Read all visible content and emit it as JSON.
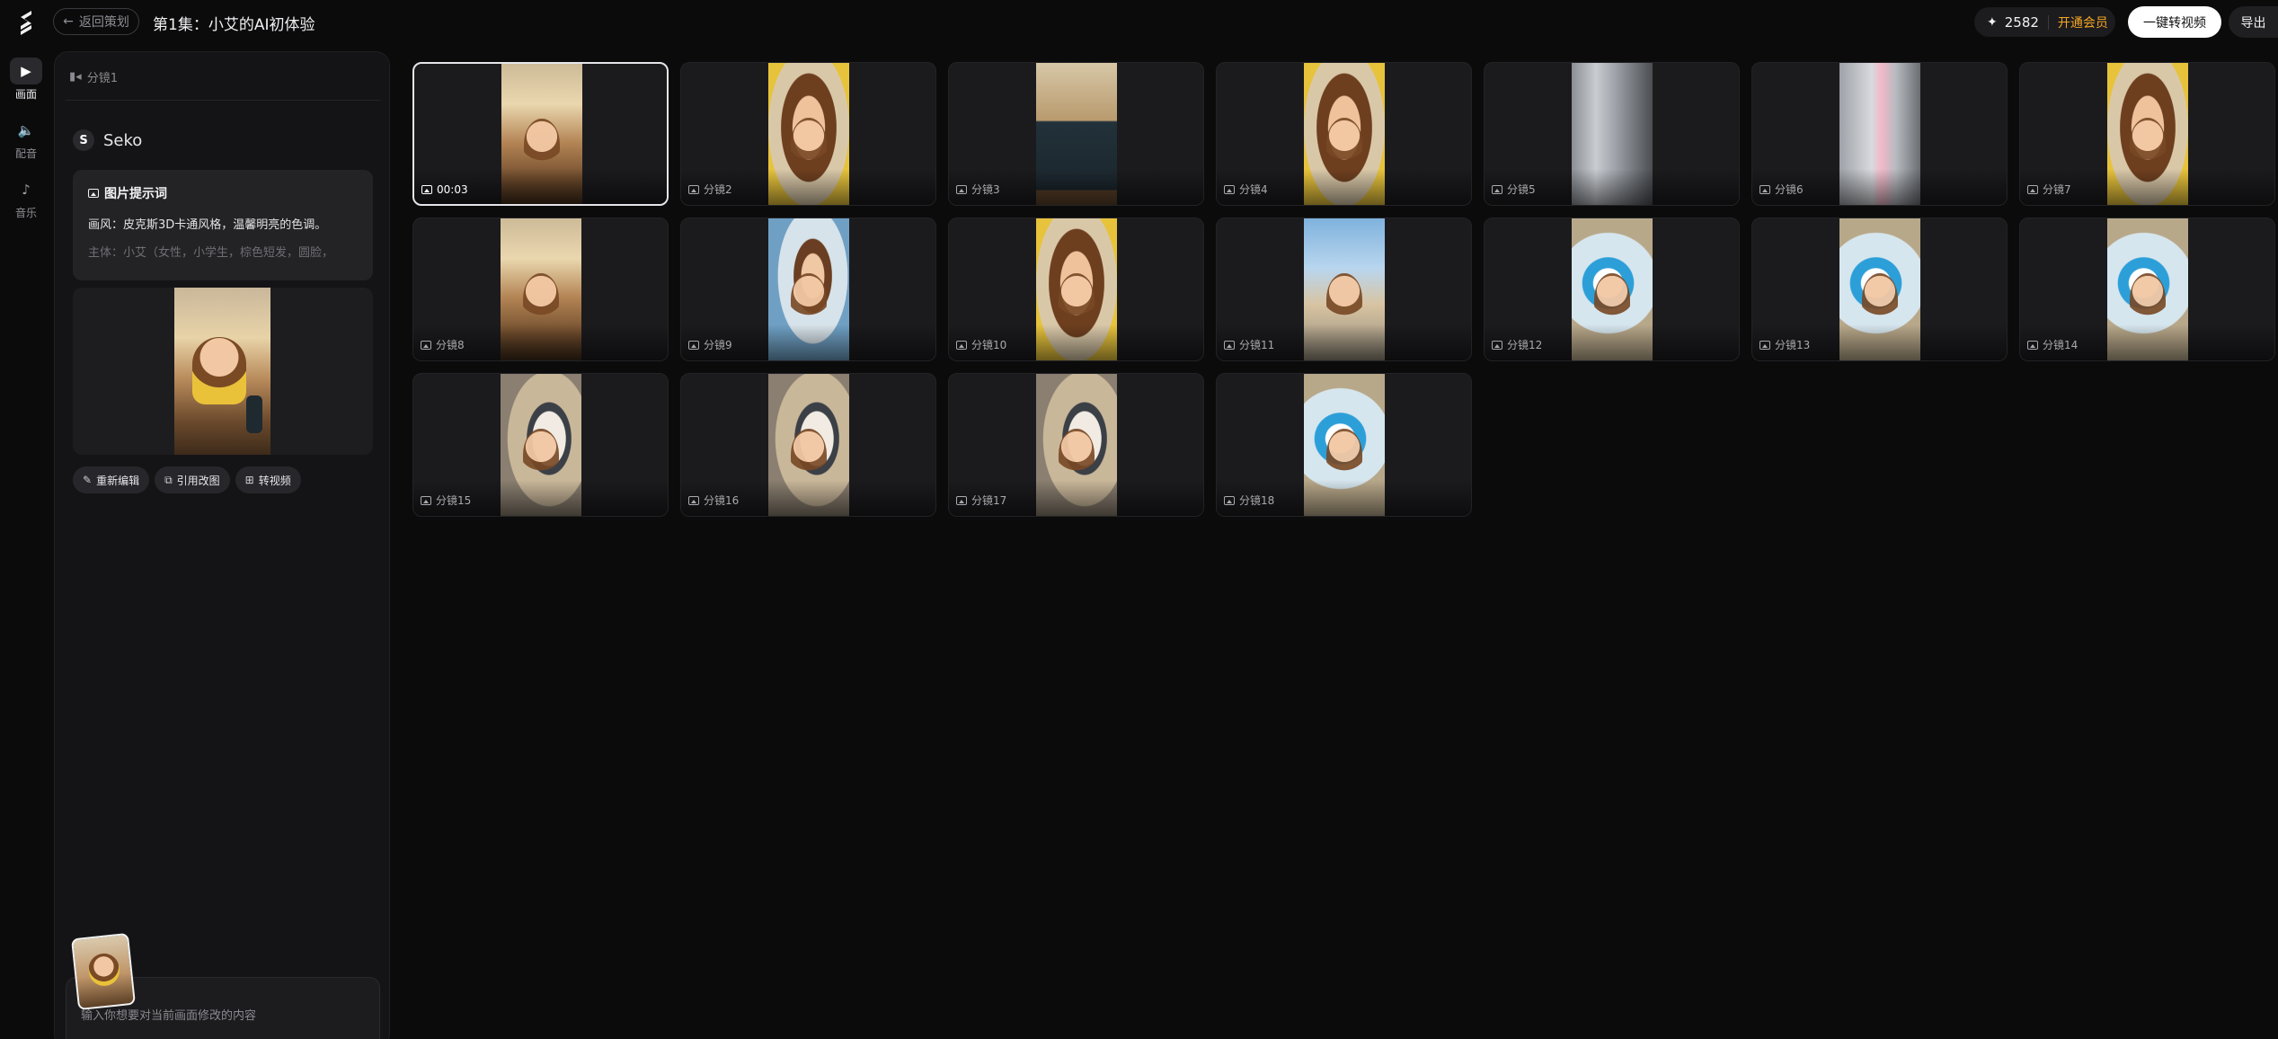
{
  "header": {
    "back_label": "返回策划",
    "episode_title": "第1集：小艾的AI初体验",
    "credits": "2582",
    "vip_label": "开通会员",
    "convert_label": "一键转视频",
    "export_label": "导出"
  },
  "rail": {
    "items": [
      {
        "label": "画面",
        "icon": "play-icon"
      },
      {
        "label": "配音",
        "icon": "speaker-icon"
      },
      {
        "label": "音乐",
        "icon": "music-icon"
      }
    ]
  },
  "panel": {
    "shot_label": "分镜1",
    "agent_name": "Seko",
    "prompt_title": "图片提示词",
    "prompt_line1": "画风：皮克斯3D卡通风格，温馨明亮的色调。",
    "prompt_line2": "主体：小艾（女性，小学生，棕色短发，圆脸，",
    "actions": [
      "重新编辑",
      "引用改图",
      "转视频"
    ],
    "input_placeholder": "输入你想要对当前画面修改的内容"
  },
  "shots": [
    {
      "label": "00:03",
      "palette": "g-room"
    },
    {
      "label": "分镜2",
      "palette": "g-face"
    },
    {
      "label": "分镜3",
      "palette": "g-speaker"
    },
    {
      "label": "分镜4",
      "palette": "g-face"
    },
    {
      "label": "分镜5",
      "palette": "g-fridge"
    },
    {
      "label": "分镜6",
      "palette": "g-fridge2"
    },
    {
      "label": "分镜7",
      "palette": "g-face"
    },
    {
      "label": "分镜8",
      "palette": "g-room"
    },
    {
      "label": "分镜9",
      "palette": "g-mom"
    },
    {
      "label": "分镜10",
      "palette": "g-face"
    },
    {
      "label": "分镜11",
      "palette": "g-street"
    },
    {
      "label": "分镜12",
      "palette": "g-robot"
    },
    {
      "label": "分镜13",
      "palette": "g-robot"
    },
    {
      "label": "分镜14",
      "palette": "g-robot"
    },
    {
      "label": "分镜15",
      "palette": "g-doc"
    },
    {
      "label": "分镜16",
      "palette": "g-doc"
    },
    {
      "label": "分镜17",
      "palette": "g-doc"
    },
    {
      "label": "分镜18",
      "palette": "g-robot"
    }
  ],
  "colors": {
    "background": "#0b0b0c",
    "panel": "#141416",
    "accent_vip": "#f5a623",
    "primary_button": "#ffffff"
  }
}
